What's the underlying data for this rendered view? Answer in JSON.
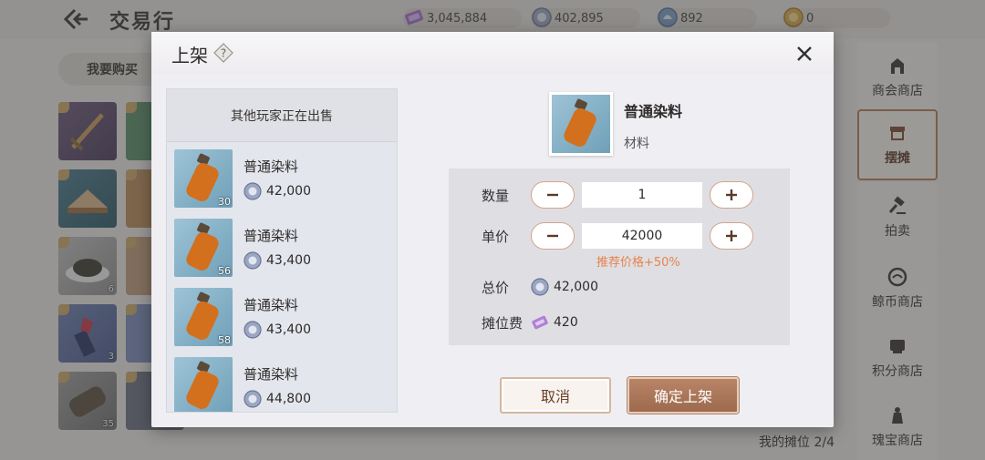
{
  "app": {
    "title": "交易行",
    "buy_tab": "我要购买",
    "my_stall": "我的摊位 2/4"
  },
  "currencies": [
    {
      "icon": "ticket-icon",
      "value": "3,045,884"
    },
    {
      "icon": "silver-coin-icon",
      "value": "402,895"
    },
    {
      "icon": "shell-coin-icon",
      "value": "892"
    },
    {
      "icon": "gold-coin-icon",
      "value": "0"
    }
  ],
  "inventory_counts": [
    "6",
    "3",
    "35"
  ],
  "side_nav": [
    {
      "label": "商会商店",
      "icon": "guild-shop-icon"
    },
    {
      "label": "摆摊",
      "icon": "stall-icon",
      "active": true
    },
    {
      "label": "拍卖",
      "icon": "gavel-icon"
    },
    {
      "label": "鲸币商店",
      "icon": "whale-coin-icon"
    },
    {
      "label": "积分商店",
      "icon": "points-shop-icon"
    },
    {
      "label": "瑰宝商店",
      "icon": "treasure-shop-icon"
    }
  ],
  "modal": {
    "title": "上架",
    "list_header": "其他玩家正在出售",
    "listings": [
      {
        "name": "普通染料",
        "price": "42,000",
        "qty": "30"
      },
      {
        "name": "普通染料",
        "price": "43,400",
        "qty": "56"
      },
      {
        "name": "普通染料",
        "price": "43,400",
        "qty": "58"
      },
      {
        "name": "普通染料",
        "price": "44,800",
        "qty": ""
      }
    ],
    "item": {
      "name": "普通染料",
      "type": "材料"
    },
    "form": {
      "qty_label": "数量",
      "qty_value": "1",
      "price_label": "单价",
      "price_value": "42000",
      "price_hint": "推荐价格+50%",
      "total_label": "总价",
      "total_value": "42,000",
      "fee_label": "摊位费",
      "fee_value": "420"
    },
    "cancel_label": "取消",
    "confirm_label": "确定上架"
  }
}
